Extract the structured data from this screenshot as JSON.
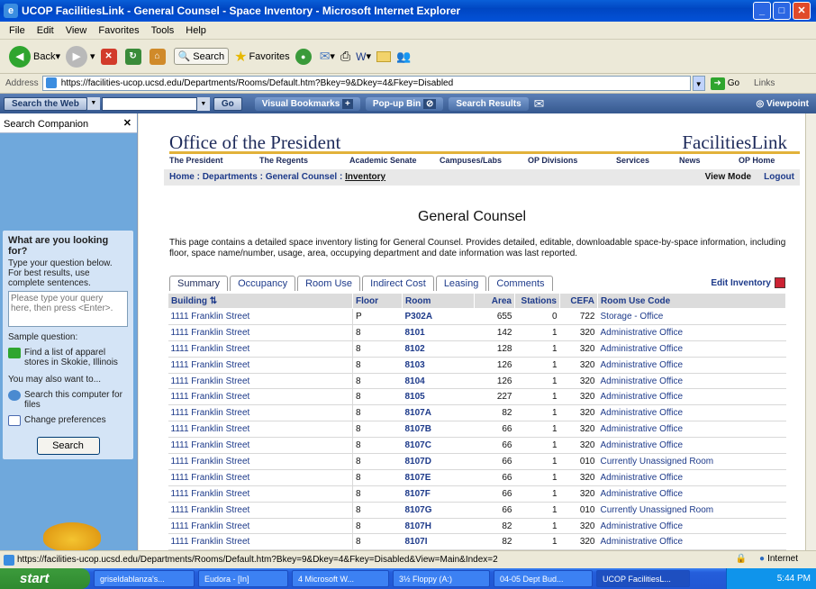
{
  "window": {
    "title": "UCOP FacilitiesLink - General Counsel - Space Inventory - Microsoft Internet Explorer"
  },
  "menu": [
    "File",
    "Edit",
    "View",
    "Favorites",
    "Tools",
    "Help"
  ],
  "toolbar": {
    "back": "Back",
    "search": "Search",
    "favorites": "Favorites"
  },
  "address": {
    "label": "Address",
    "url": "https://facilities-ucop.ucsd.edu/Departments/Rooms/Default.htm?Bkey=9&Dkey=4&Fkey=Disabled",
    "go": "Go",
    "links": "Links"
  },
  "searchbar": {
    "search_web": "Search the Web",
    "go": "Go",
    "visual_bookmarks": "Visual Bookmarks",
    "popup_bin": "Pop-up Bin",
    "search_results": "Search Results",
    "viewpoint": "Viewpoint"
  },
  "companion": {
    "header": "Search Companion",
    "what": "What are you looking for?",
    "instructions": "Type your question below. For best results, use complete sentences.",
    "placeholder": "Please type your query here, then press <Enter>.",
    "sample_label": "Sample question:",
    "sample": "Find a list of apparel stores in Skokie, Illinois",
    "also": "You may also want to...",
    "opt1": "Search this computer for files",
    "opt2": "Change preferences",
    "search_button": "Search"
  },
  "site": {
    "left_title": "Office of the President",
    "right_title": "FacilitiesLink",
    "nav": [
      "The President",
      "The Regents",
      "Academic Senate",
      "Campuses/Labs",
      "OP Divisions",
      "Services",
      "News",
      "OP Home"
    ],
    "breadcrumb_home": "Home",
    "breadcrumb_dept": "Departments",
    "breadcrumb_gc": "General Counsel",
    "breadcrumb_inv": "Inventory",
    "view_mode": "View Mode",
    "logout": "Logout",
    "page_title": "General Counsel",
    "description": "This page contains a detailed space inventory listing for General Counsel. Provides detailed, editable, downloadable space-by-space information, including floor, space name/number, usage, area, occupying department and date information was last reported.",
    "tabs": [
      "Summary",
      "Occupancy",
      "Room Use",
      "Indirect Cost",
      "Leasing",
      "Comments"
    ],
    "edit_inventory": "Edit Inventory"
  },
  "table": {
    "headers": [
      "Building",
      "Floor",
      "Room",
      "Area",
      "Stations",
      "CEFA",
      "Room Use Code"
    ],
    "rows": [
      [
        "1111 Franklin Street",
        "P",
        "P302A",
        "655",
        "0",
        "722",
        "Storage - Office"
      ],
      [
        "1111 Franklin Street",
        "8",
        "8101",
        "142",
        "1",
        "320",
        "Administrative Office"
      ],
      [
        "1111 Franklin Street",
        "8",
        "8102",
        "128",
        "1",
        "320",
        "Administrative Office"
      ],
      [
        "1111 Franklin Street",
        "8",
        "8103",
        "126",
        "1",
        "320",
        "Administrative Office"
      ],
      [
        "1111 Franklin Street",
        "8",
        "8104",
        "126",
        "1",
        "320",
        "Administrative Office"
      ],
      [
        "1111 Franklin Street",
        "8",
        "8105",
        "227",
        "1",
        "320",
        "Administrative Office"
      ],
      [
        "1111 Franklin Street",
        "8",
        "8107A",
        "82",
        "1",
        "320",
        "Administrative Office"
      ],
      [
        "1111 Franklin Street",
        "8",
        "8107B",
        "66",
        "1",
        "320",
        "Administrative Office"
      ],
      [
        "1111 Franklin Street",
        "8",
        "8107C",
        "66",
        "1",
        "320",
        "Administrative Office"
      ],
      [
        "1111 Franklin Street",
        "8",
        "8107D",
        "66",
        "1",
        "010",
        "Currently Unassigned Room"
      ],
      [
        "1111 Franklin Street",
        "8",
        "8107E",
        "66",
        "1",
        "320",
        "Administrative Office"
      ],
      [
        "1111 Franklin Street",
        "8",
        "8107F",
        "66",
        "1",
        "320",
        "Administrative Office"
      ],
      [
        "1111 Franklin Street",
        "8",
        "8107G",
        "66",
        "1",
        "010",
        "Currently Unassigned Room"
      ],
      [
        "1111 Franklin Street",
        "8",
        "8107H",
        "82",
        "1",
        "320",
        "Administrative Office"
      ],
      [
        "1111 Franklin Street",
        "8",
        "8107I",
        "82",
        "1",
        "320",
        "Administrative Office"
      ]
    ]
  },
  "status": {
    "url": "https://facilities-ucop.ucsd.edu/Departments/Rooms/Default.htm?Bkey=9&Dkey=4&Fkey=Disabled&View=Main&Index=2",
    "zone": "Internet"
  },
  "taskbar": {
    "start": "start",
    "tasks": [
      "griseldablanza's...",
      "Eudora - [In]",
      "4 Microsoft W...",
      "3½ Floppy (A:)",
      "04-05 Dept Bud...",
      "UCOP FacilitiesL..."
    ],
    "clock": "5:44 PM"
  }
}
